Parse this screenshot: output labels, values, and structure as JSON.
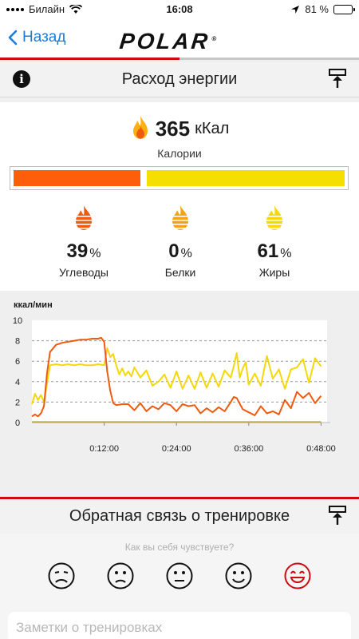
{
  "status_bar": {
    "carrier": "Билайн",
    "time": "16:08",
    "battery": "81 %",
    "battery_level": 0.81
  },
  "nav": {
    "back_label": "Назад",
    "logo": "POLAR"
  },
  "energy_section": {
    "title": "Расход энергии"
  },
  "calories": {
    "value": "365",
    "unit": "кКал",
    "label": "Калории"
  },
  "macros": [
    {
      "name": "Углеводы",
      "percent": "39",
      "color": "#f05a0e"
    },
    {
      "name": "Белки",
      "percent": "0",
      "color": "#f3a21a"
    },
    {
      "name": "Жиры",
      "percent": "61",
      "color": "#f4d80c"
    }
  ],
  "energy_bar": {
    "carb_fraction": 0.39,
    "fat_fraction": 0.61,
    "carb_color": "#fd5e0b",
    "fat_color": "#f5df00"
  },
  "chart_data": {
    "type": "line",
    "ylabel": "ккал/мин",
    "ylim": [
      0,
      10
    ],
    "yticks": [
      "0",
      "2",
      "4",
      "6",
      "8",
      "10"
    ],
    "xlim": [
      0,
      49
    ],
    "xticks": [
      {
        "label": "0:12:00",
        "value": 12
      },
      {
        "label": "0:24:00",
        "value": 24
      },
      {
        "label": "0:36:00",
        "value": 36
      },
      {
        "label": "0:48:00",
        "value": 48
      }
    ],
    "series": [
      {
        "color": "#f4d80c",
        "x": [
          0,
          0.5,
          1,
          1.5,
          2,
          2.5,
          3,
          4,
          5,
          6,
          7,
          8,
          9,
          10,
          11,
          12,
          12.5,
          13,
          13.5,
          14,
          14.5,
          15,
          15.5,
          16,
          16.5,
          17,
          18,
          19,
          20,
          21,
          22,
          23,
          24,
          25,
          26,
          27,
          28,
          29,
          30,
          31,
          32,
          33,
          33.5,
          34,
          34.5,
          35,
          35.5,
          36,
          37,
          38,
          39,
          40,
          41,
          42,
          43,
          44,
          45,
          46,
          47,
          48
        ],
        "y": [
          1.8,
          2.8,
          2.2,
          2.7,
          2.0,
          3.8,
          5.6,
          5.7,
          5.6,
          5.7,
          5.6,
          5.7,
          5.6,
          5.6,
          5.7,
          5.6,
          7.3,
          6.4,
          6.7,
          5.6,
          4.7,
          5.3,
          4.6,
          5.0,
          4.5,
          5.4,
          4.4,
          5.1,
          3.6,
          4.0,
          4.7,
          3.4,
          5.0,
          3.3,
          4.6,
          3.3,
          4.9,
          3.4,
          4.8,
          3.5,
          5.1,
          4.4,
          5.5,
          6.8,
          4.4,
          5.3,
          5.9,
          3.7,
          4.8,
          3.6,
          6.5,
          4.3,
          5.2,
          3.3,
          5.2,
          5.4,
          6.2,
          3.9,
          6.3,
          5.5
        ]
      },
      {
        "color": "#f05a0e",
        "x": [
          0,
          0.5,
          1,
          1.5,
          2,
          2.5,
          3,
          4,
          5,
          6,
          7,
          8,
          9,
          10,
          11,
          11.5,
          12,
          12.5,
          13,
          13.5,
          14,
          15,
          16,
          17,
          18,
          19,
          20,
          21,
          22,
          23,
          24,
          25,
          26,
          27,
          28,
          29,
          30,
          31,
          32,
          33,
          33.5,
          34,
          35,
          36,
          37,
          38,
          39,
          40,
          41,
          42,
          43,
          44,
          45,
          46,
          47,
          48
        ],
        "y": [
          0.6,
          0.8,
          0.6,
          0.9,
          1.6,
          4.8,
          6.9,
          7.6,
          7.8,
          7.9,
          8.0,
          8.1,
          8.1,
          8.2,
          8.2,
          8.3,
          7.9,
          5.0,
          3.1,
          1.9,
          1.7,
          1.8,
          1.8,
          1.2,
          1.9,
          1.1,
          1.6,
          1.3,
          1.9,
          1.7,
          1.1,
          1.8,
          1.6,
          1.7,
          0.9,
          1.4,
          1.0,
          1.5,
          1.1,
          2.0,
          2.5,
          2.4,
          1.3,
          1.0,
          0.7,
          1.6,
          0.9,
          1.1,
          0.8,
          2.2,
          1.4,
          3.0,
          2.4,
          2.9,
          1.9,
          2.6
        ]
      },
      {
        "color": "#b9a54a",
        "x": [
          0,
          48
        ],
        "y": [
          0.05,
          0.05
        ]
      }
    ]
  },
  "feedback_section": {
    "title": "Обратная связь о тренировке",
    "question": "Как вы себя чувствуете?",
    "notes_placeholder": "Заметки о тренировках"
  }
}
